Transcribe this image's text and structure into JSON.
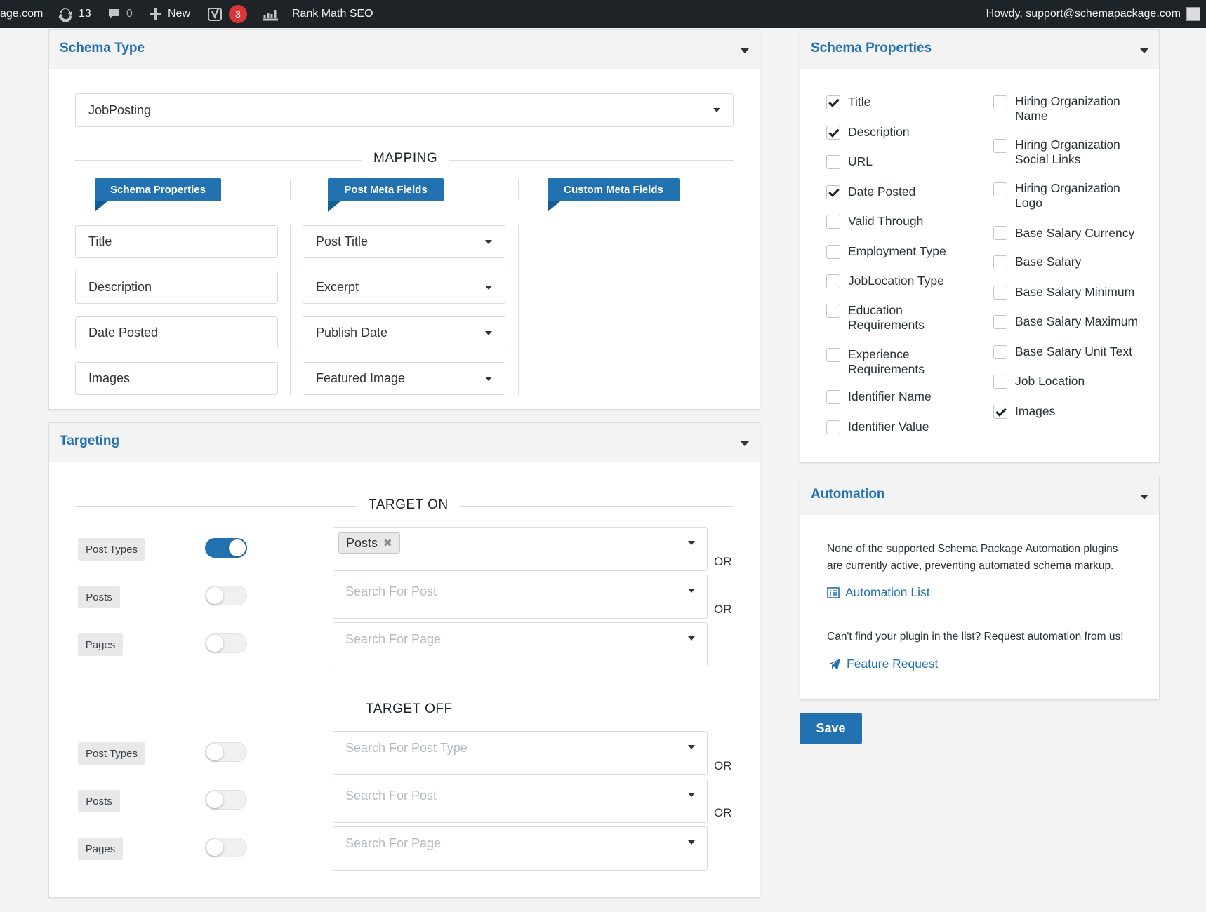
{
  "adminbar": {
    "site": "age.com",
    "updates_count": "13",
    "comments_count": "0",
    "new_label": "New",
    "yoast_badge": "3",
    "rankmath_label": "Rank Math SEO",
    "howdy": "Howdy, support@schemapackage.com"
  },
  "schema_type": {
    "title": "Schema Type",
    "selected": "JobPosting",
    "mapping_label": "MAPPING",
    "ribbons": [
      "Schema Properties",
      "Post Meta Fields",
      "Custom Meta Fields"
    ],
    "rows": [
      {
        "property": "Title",
        "meta": "Post Title"
      },
      {
        "property": "Description",
        "meta": "Excerpt"
      },
      {
        "property": "Date Posted",
        "meta": "Publish Date"
      },
      {
        "property": "Images",
        "meta": "Featured Image"
      }
    ]
  },
  "targeting": {
    "title": "Targeting",
    "target_on_label": "TARGET ON",
    "target_off_label": "TARGET OFF",
    "on": [
      {
        "tag": "Post Types",
        "toggle_on": true,
        "chip": "Posts",
        "placeholder": ""
      },
      {
        "tag": "Posts",
        "toggle_on": false,
        "placeholder": "Search For Post"
      },
      {
        "tag": "Pages",
        "toggle_on": false,
        "placeholder": "Search For Page"
      }
    ],
    "off": [
      {
        "tag": "Post Types",
        "toggle_on": false,
        "placeholder": "Search For Post Type"
      },
      {
        "tag": "Posts",
        "toggle_on": false,
        "placeholder": "Search For Post"
      },
      {
        "tag": "Pages",
        "toggle_on": false,
        "placeholder": "Search For Page"
      }
    ],
    "or_label": "OR"
  },
  "schema_properties": {
    "title": "Schema Properties",
    "left": [
      {
        "label": "Title",
        "checked": true
      },
      {
        "label": "Description",
        "checked": true
      },
      {
        "label": "URL",
        "checked": false
      },
      {
        "label": "Date Posted",
        "checked": true
      },
      {
        "label": "Valid Through",
        "checked": false
      },
      {
        "label": "Employment Type",
        "checked": false
      },
      {
        "label": "JobLocation Type",
        "checked": false
      },
      {
        "label": "Education Requirements",
        "checked": false
      },
      {
        "label": "Experience Requirements",
        "checked": false
      },
      {
        "label": "Identifier Name",
        "checked": false
      },
      {
        "label": "Identifier Value",
        "checked": false
      }
    ],
    "right": [
      {
        "label": "Hiring Organization Name",
        "checked": false
      },
      {
        "label": "Hiring Organization Social Links",
        "checked": false
      },
      {
        "label": "Hiring Organization Logo",
        "checked": false
      },
      {
        "label": "Base Salary Currency",
        "checked": false
      },
      {
        "label": "Base Salary",
        "checked": false
      },
      {
        "label": "Base Salary Minimum",
        "checked": false
      },
      {
        "label": "Base Salary Maximum",
        "checked": false
      },
      {
        "label": "Base Salary Unit Text",
        "checked": false
      },
      {
        "label": "Job Location",
        "checked": false
      },
      {
        "label": "Images",
        "checked": true
      }
    ]
  },
  "automation": {
    "title": "Automation",
    "notice": "None of the supported Schema Package Automation plugins are currently active, preventing automated schema markup.",
    "list_link": "Automation List",
    "request_text": "Can't find your plugin in the list? Request automation from us!",
    "feature_link": "Feature Request"
  },
  "save_label": "Save",
  "colors": {
    "accent": "#2271b1",
    "adminbar": "#1d2327",
    "badge": "#d63638"
  }
}
